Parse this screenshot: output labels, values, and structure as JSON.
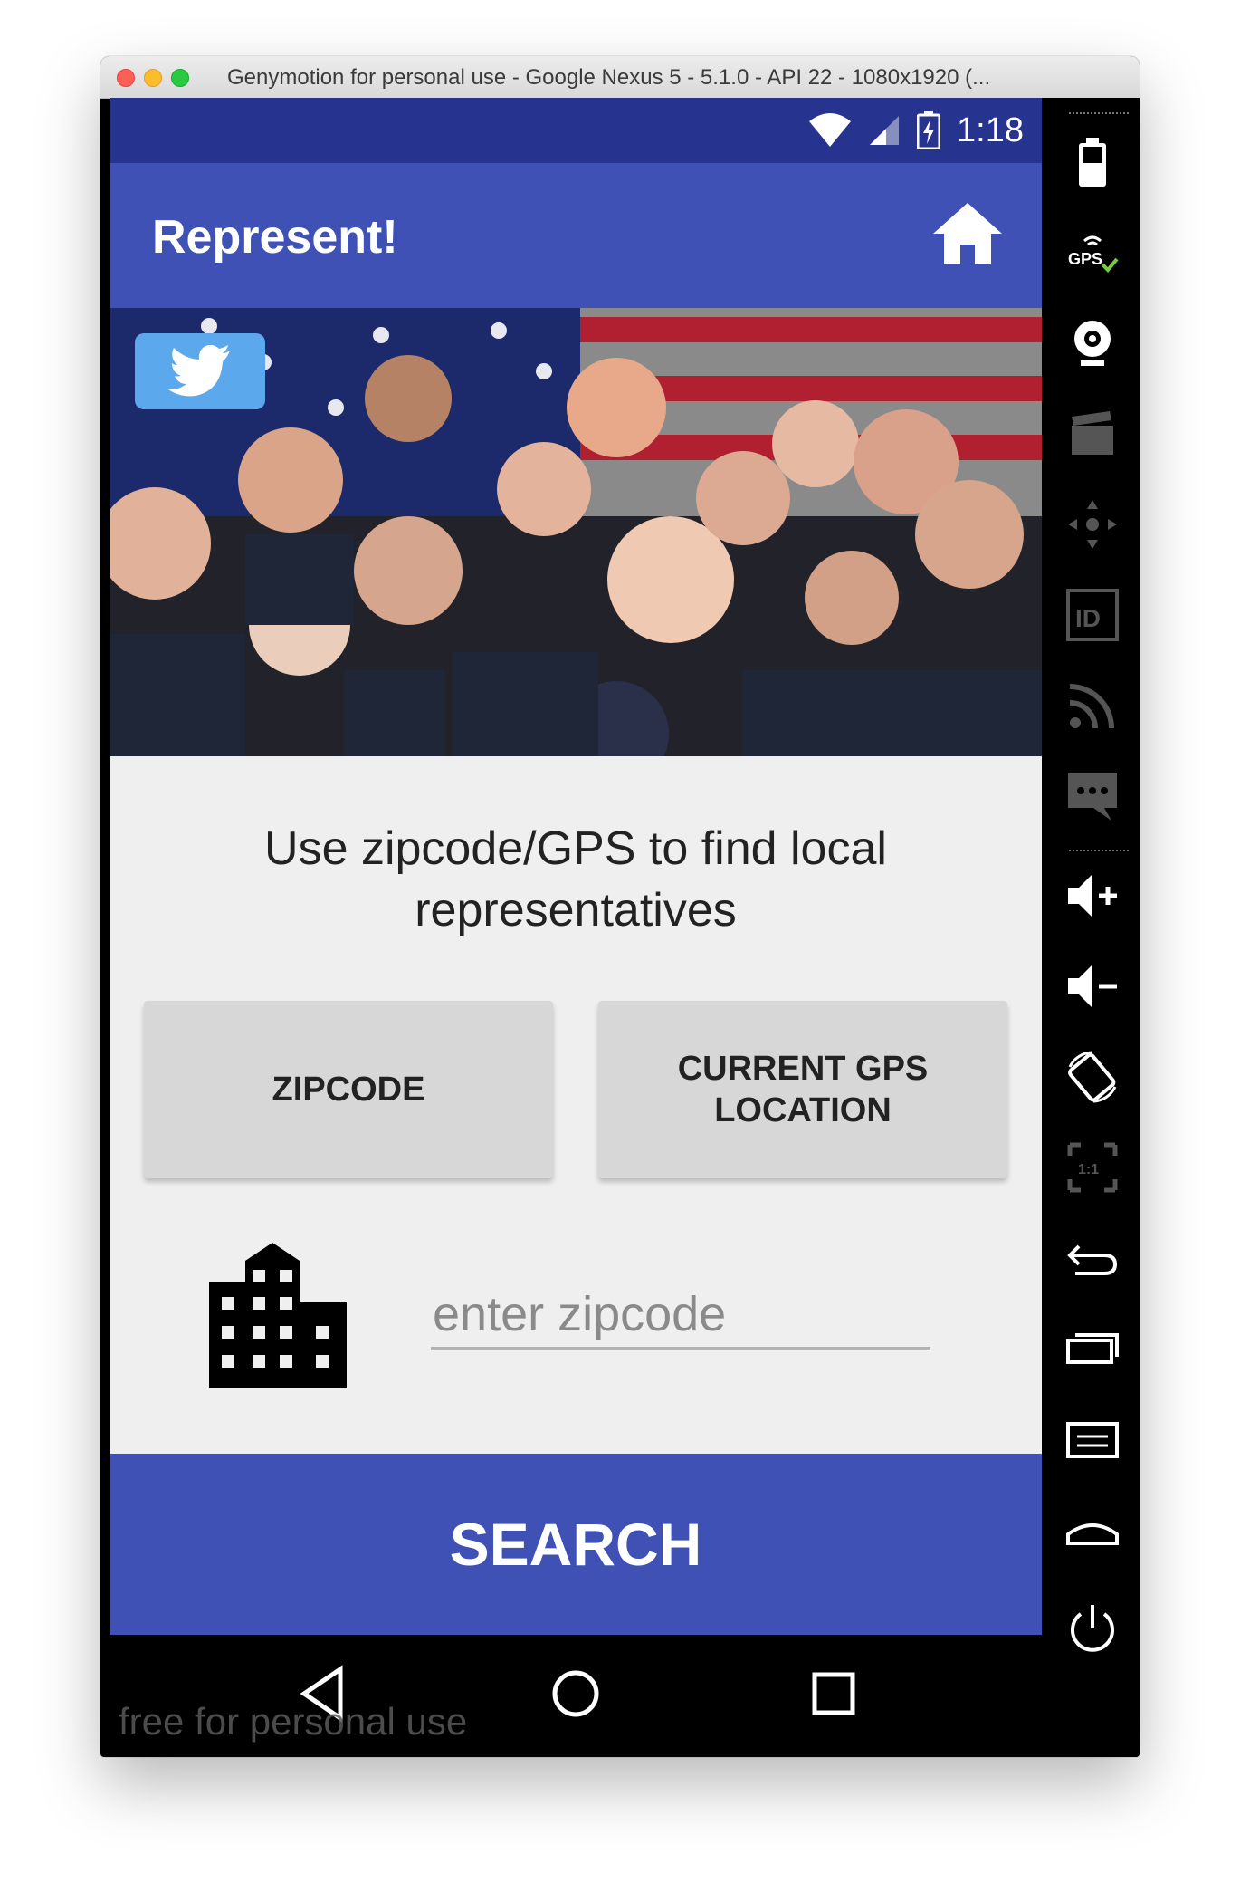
{
  "window": {
    "title": "Genymotion for personal use - Google Nexus 5 - 5.1.0 - API 22 - 1080x1920 (..."
  },
  "status_bar": {
    "time": "1:18"
  },
  "app_bar": {
    "title": "Represent!"
  },
  "content": {
    "prompt": "Use zipcode/GPS to find local representatives",
    "zipcode_button": "ZIPCODE",
    "gps_button": "CURRENT GPS LOCATION",
    "zipcode_placeholder": "enter zipcode",
    "search_button": "SEARCH"
  },
  "nav": {
    "watermark": "free for personal use"
  },
  "sidebar": {
    "gps_label": "GPS",
    "id_label": "ID",
    "scale_label": "1:1"
  },
  "colors": {
    "primary": "#3f51b5",
    "primary_dark": "#26338f",
    "twitter": "#5ba9ec",
    "background": "#efefef",
    "button": "#d7d7d7"
  },
  "icons": [
    "home-icon",
    "twitter-icon",
    "building-icon",
    "wifi-icon",
    "signal-icon",
    "battery-icon",
    "back-icon",
    "home-nav-icon",
    "recents-icon"
  ]
}
